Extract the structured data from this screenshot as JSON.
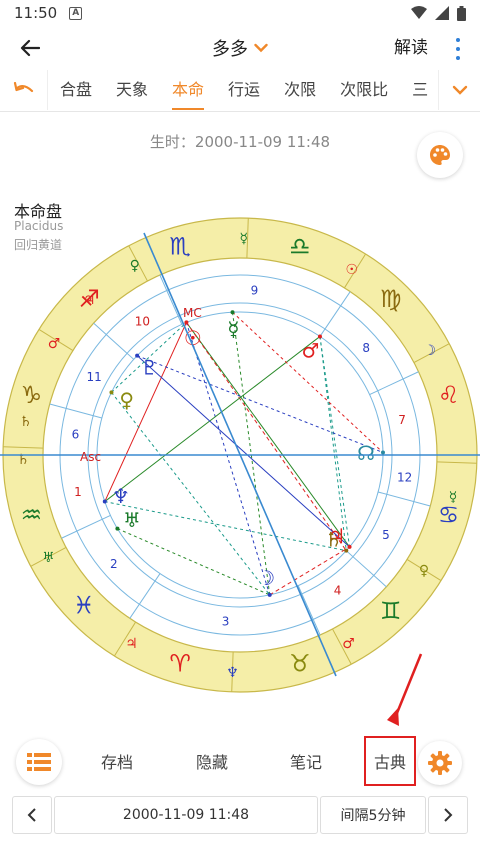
{
  "status_bar": {
    "time": "11:50",
    "notification_glyph": "A"
  },
  "app_bar": {
    "title": "多多",
    "read_label": "解读"
  },
  "tabs": [
    {
      "label": "合盘",
      "active": false
    },
    {
      "label": "天象",
      "active": false
    },
    {
      "label": "本命",
      "active": true
    },
    {
      "label": "行运",
      "active": false
    },
    {
      "label": "次限",
      "active": false
    },
    {
      "label": "次限比",
      "active": false
    },
    {
      "label": "三",
      "active": false
    }
  ],
  "birth_time": "生时：2000-11-09 11:48",
  "chart_info": {
    "name": "本命盘",
    "house_system": "Placidus",
    "zodiac": "回归黄道"
  },
  "chart": {
    "asc_label": "Asc",
    "mc_label": "MC",
    "house_numbers": [
      "1",
      "2",
      "3",
      "4",
      "5",
      "6",
      "7",
      "8",
      "9",
      "10",
      "11",
      "12"
    ],
    "signs": [
      {
        "glyph": "♒",
        "color": "#1a7a2a"
      },
      {
        "glyph": "♓",
        "color": "#2a3fc0"
      },
      {
        "glyph": "♈",
        "color": "#e02020"
      },
      {
        "glyph": "♉",
        "color": "#8a8a10"
      },
      {
        "glyph": "♊",
        "color": "#1a7a2a"
      },
      {
        "glyph": "♋",
        "color": "#2a3fc0"
      },
      {
        "glyph": "♌",
        "color": "#e02020"
      },
      {
        "glyph": "♍",
        "color": "#8a6a10"
      },
      {
        "glyph": "♎",
        "color": "#1a7a2a"
      },
      {
        "glyph": "♏",
        "color": "#2a3fc0"
      },
      {
        "glyph": "♐",
        "color": "#e02020"
      },
      {
        "glyph": "♑",
        "color": "#8a6a10"
      }
    ],
    "rulers": [
      {
        "glyph": "♄",
        "color": "#8a6a10"
      },
      {
        "glyph": "♅",
        "color": "#1a7a2a"
      },
      {
        "glyph": "♃",
        "color": "#e02020"
      },
      {
        "glyph": "♆",
        "color": "#2a3fc0"
      },
      {
        "glyph": "♂",
        "color": "#e02020"
      },
      {
        "glyph": "♀",
        "color": "#8a8a10"
      },
      {
        "glyph": "☿",
        "color": "#1a7a2a"
      },
      {
        "glyph": "☽",
        "color": "#2a3fc0"
      },
      {
        "glyph": "☉",
        "color": "#e02020"
      },
      {
        "glyph": "☿",
        "color": "#1a7a2a"
      },
      {
        "glyph": "♀",
        "color": "#1a7a2a"
      },
      {
        "glyph": "♂",
        "color": "#e02020"
      },
      {
        "glyph": "♃",
        "color": "#e02020"
      },
      {
        "glyph": "♄",
        "color": "#8a6a10"
      }
    ],
    "planets": [
      {
        "glyph": "☉",
        "color": "#e02020"
      },
      {
        "glyph": "☿",
        "color": "#1a7a2a"
      },
      {
        "glyph": "♂",
        "color": "#e02020"
      },
      {
        "glyph": "♇",
        "color": "#2a3fc0"
      },
      {
        "glyph": "♀",
        "color": "#8a8a10"
      },
      {
        "glyph": "☊",
        "color": "#2a8aa0"
      },
      {
        "glyph": "♆",
        "color": "#2a3fc0"
      },
      {
        "glyph": "♅",
        "color": "#1a7a2a"
      },
      {
        "glyph": "♃",
        "color": "#e02020"
      },
      {
        "glyph": "♄",
        "color": "#8a6a10"
      },
      {
        "glyph": "☽",
        "color": "#2a3fc0"
      }
    ]
  },
  "toolbar": {
    "archive": "存档",
    "hide": "隐藏",
    "notes": "笔记",
    "classic": "古典"
  },
  "nav": {
    "datetime": "2000-11-09 11:48",
    "interval": "间隔5分钟"
  },
  "colors": {
    "accent": "#f0882a",
    "link": "#2f7fd8",
    "highlight": "#e02020",
    "ring": "#f5eea8"
  }
}
